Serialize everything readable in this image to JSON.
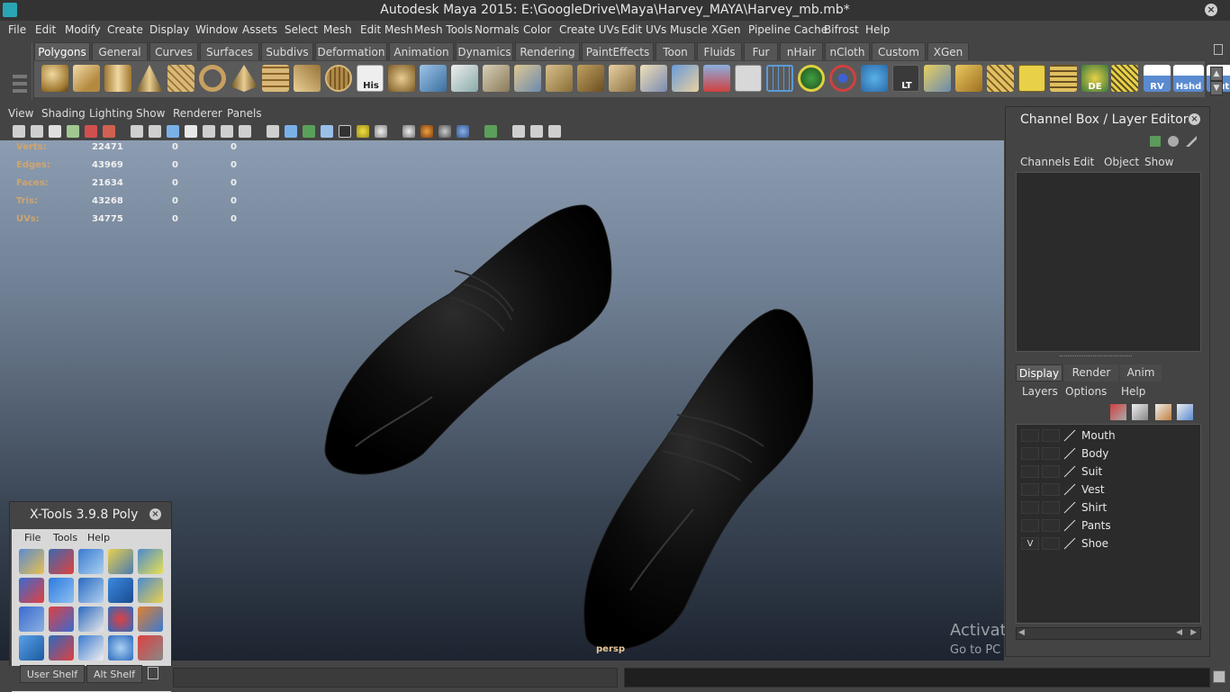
{
  "window": {
    "title": "Autodesk Maya 2015: E:\\GoogleDrive\\Maya\\Harvey_MAYA\\Harvey_mb.mb*"
  },
  "menubar": [
    "File",
    "Edit",
    "Modify",
    "Create",
    "Display",
    "Window",
    "Assets",
    "Select",
    "Mesh",
    "Edit Mesh",
    "Mesh Tools",
    "Normals",
    "Color",
    "Create UVs",
    "Edit UVs",
    "Muscle",
    "XGen",
    "Pipeline Cache",
    "Bifrost",
    "Help"
  ],
  "shelf": {
    "tabs": [
      "Polygons",
      "General",
      "Curves",
      "Surfaces",
      "Subdivs",
      "Deformation",
      "Animation",
      "Dynamics",
      "Rendering",
      "PaintEffects",
      "Toon",
      "Fluids",
      "Fur",
      "nHair",
      "nCloth",
      "Custom",
      "XGen"
    ],
    "active_tab": "Polygons",
    "icon_labels": {
      "his": "His",
      "lt": "LT",
      "de": "DE",
      "rv": "RV",
      "hshd": "Hshd",
      "out": "Out"
    }
  },
  "panel_menu": [
    "View",
    "Shading",
    "Lighting",
    "Show",
    "Renderer",
    "Panels"
  ],
  "hud": [
    {
      "label": "Verts:",
      "v1": "22471",
      "v2": "0",
      "v3": "0"
    },
    {
      "label": "Edges:",
      "v1": "43969",
      "v2": "0",
      "v3": "0"
    },
    {
      "label": "Faces:",
      "v1": "21634",
      "v2": "0",
      "v3": "0"
    },
    {
      "label": "Tris:",
      "v1": "43268",
      "v2": "0",
      "v3": "0"
    },
    {
      "label": "UVs:",
      "v1": "34775",
      "v2": "0",
      "v3": "0"
    }
  ],
  "viewport": {
    "camera": "persp",
    "watermark_title": "Activate Windows",
    "watermark_sub": "Go to PC settings to activate Windows."
  },
  "channel_box": {
    "title": "Channel Box / Layer Editor",
    "menu": [
      "Channels",
      "Edit",
      "Object",
      "Show"
    ],
    "layer_tabs": [
      "Display",
      "Render",
      "Anim"
    ],
    "active_layer_tab": "Display",
    "layer_menu": [
      "Layers",
      "Options",
      "Help"
    ],
    "layers": [
      {
        "name": "Mouth",
        "visible": ""
      },
      {
        "name": "Body",
        "visible": ""
      },
      {
        "name": "Suit",
        "visible": ""
      },
      {
        "name": "Vest",
        "visible": ""
      },
      {
        "name": "Shirt",
        "visible": ""
      },
      {
        "name": "Pants",
        "visible": ""
      },
      {
        "name": "Shoe",
        "visible": "V"
      }
    ]
  },
  "xtools": {
    "title": "X-Tools 3.9.8 Poly",
    "menu": [
      "File",
      "Tools",
      "Help"
    ]
  },
  "bottom_tabs": [
    "User Shelf",
    "Alt Shelf"
  ]
}
